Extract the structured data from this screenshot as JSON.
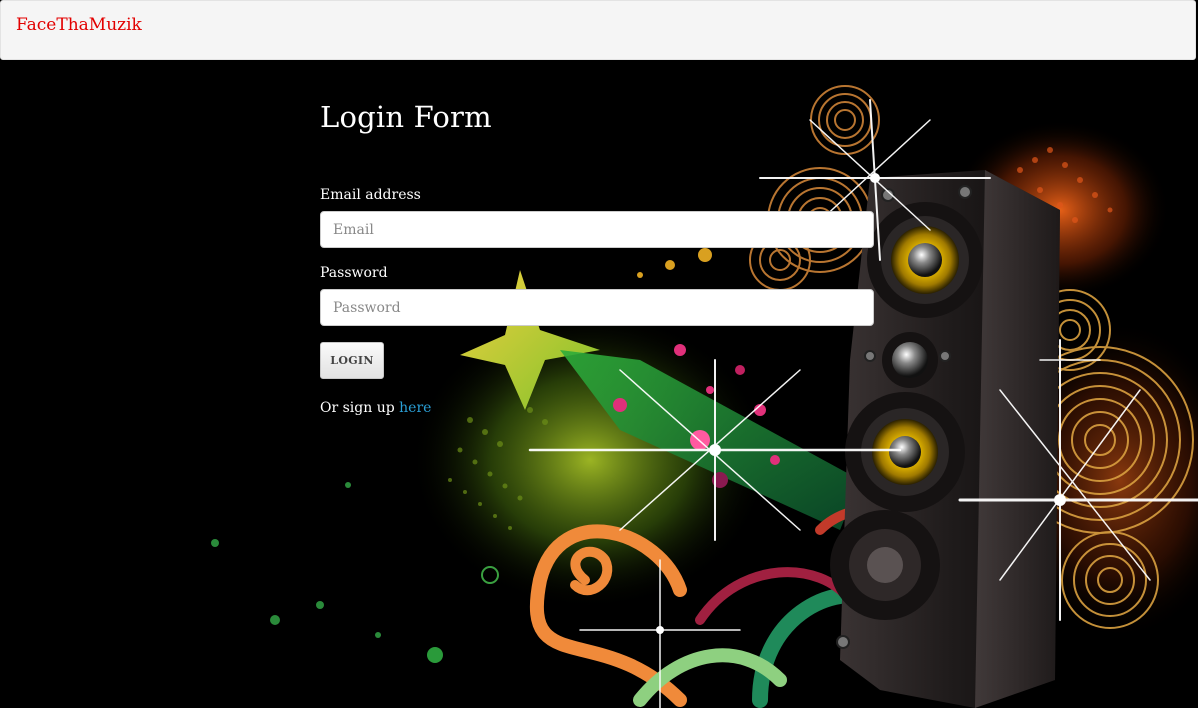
{
  "navbar": {
    "brand": "FaceThaMuzik"
  },
  "form": {
    "title": "Login Form",
    "email_label": "Email address",
    "email_value": "",
    "email_placeholder": "Email",
    "password_label": "Password",
    "password_value": "",
    "password_placeholder": "Password",
    "login_button": "LOGIN",
    "signup_prefix": "Or sign up ",
    "signup_link": "here"
  },
  "colors": {
    "brand": "#e20000",
    "link": "#2a9fd6",
    "page_background": "#000000",
    "navbar_background": "#f5f5f5"
  },
  "background_art": "music-speaker-illustration"
}
